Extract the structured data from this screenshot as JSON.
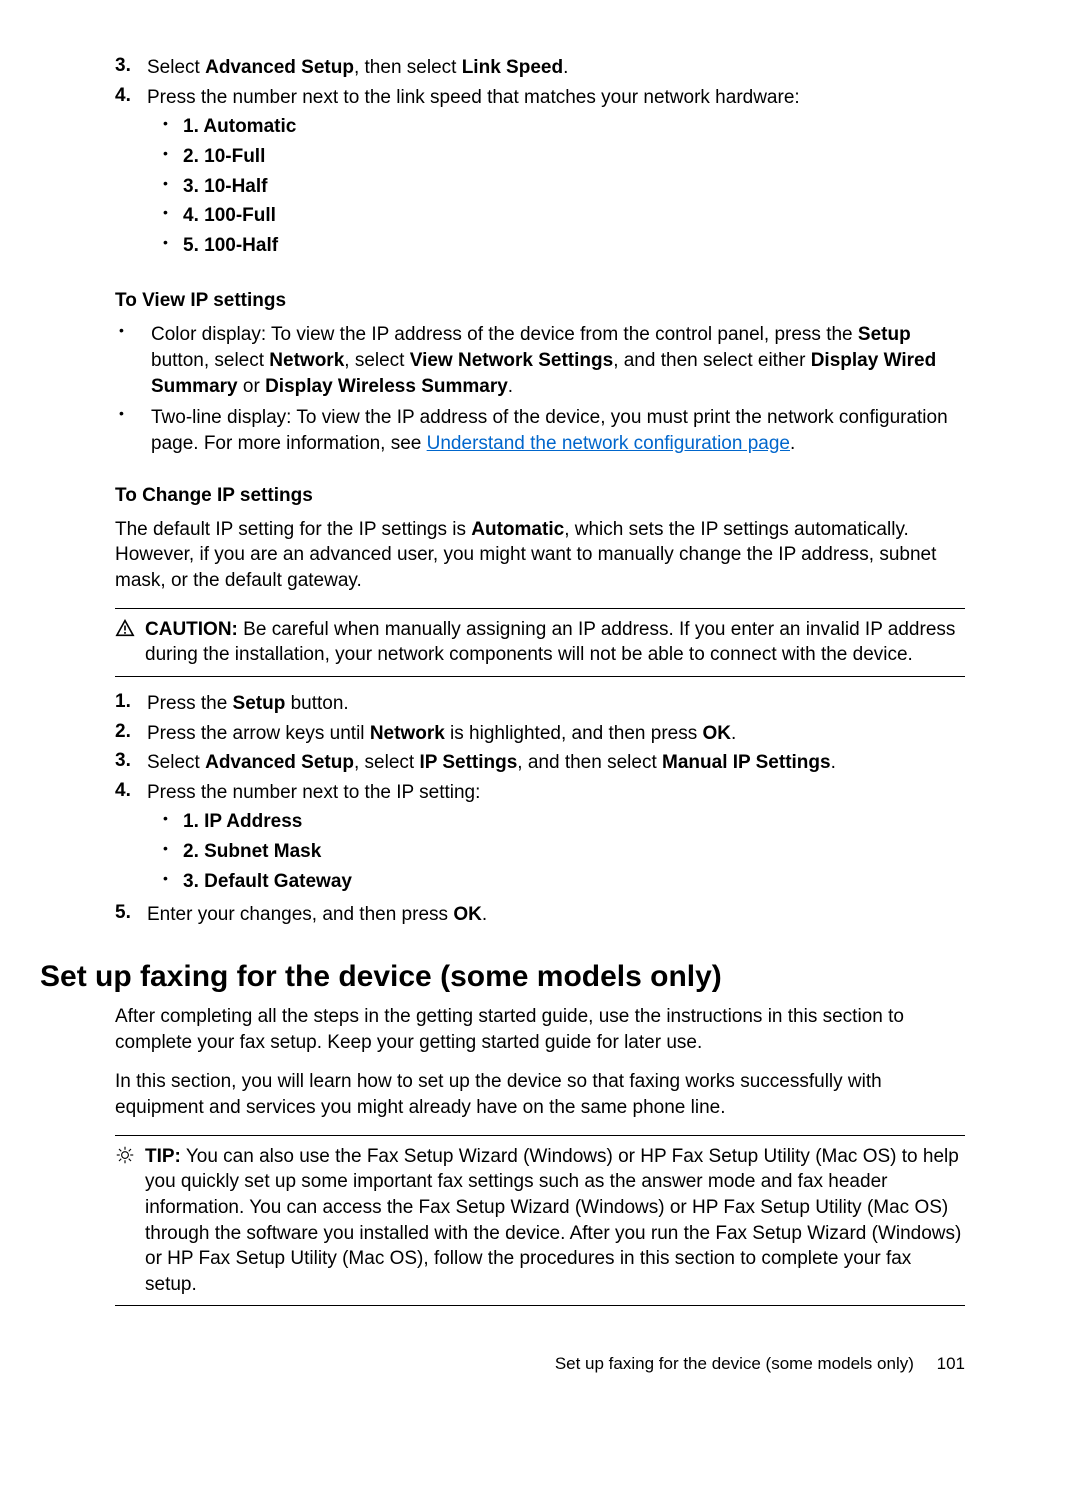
{
  "intro_list": [
    {
      "num": "3.",
      "pre": "Select ",
      "b1": "Advanced Setup",
      "mid": ", then select ",
      "b2": "Link Speed",
      "post": "."
    },
    {
      "num": "4.",
      "text": "Press the number next to the link speed that matches your network hardware:",
      "sub": [
        "1. Automatic",
        "2. 10-Full",
        "3. 10-Half",
        "4. 100-Full",
        "5. 100-Half"
      ]
    }
  ],
  "view_ip": {
    "heading": "To View IP settings",
    "items": [
      {
        "pre": "Color display: To view the IP address of the device from the control panel, press the ",
        "b1": "Setup",
        "m1": " button, select ",
        "b2": "Network",
        "m2": ", select ",
        "b3": "View Network Settings",
        "m3": ", and then select either ",
        "b4": "Display Wired Summary",
        "m4": " or ",
        "b5": "Display Wireless Summary",
        "post": "."
      },
      {
        "pre": "Two-line display: To view the IP address of the device, you must print the network configuration page. For more information, see ",
        "link": "Understand the network configuration page",
        "post": "."
      }
    ]
  },
  "change_ip": {
    "heading": "To Change IP settings",
    "para_pre": "The default IP setting for the IP settings is ",
    "para_bold": "Automatic",
    "para_post": ", which sets the IP settings automatically. However, if you are an advanced user, you might want to manually change the IP address, subnet mask, or the default gateway.",
    "caution_label": "CAUTION:",
    "caution_text": "Be careful when manually assigning an IP address. If you enter an invalid IP address during the installation, your network components will not be able to connect with the device.",
    "steps": [
      {
        "num": "1.",
        "pre": "Press the ",
        "b1": "Setup",
        "post": " button."
      },
      {
        "num": "2.",
        "pre": "Press the arrow keys until ",
        "b1": "Network",
        "mid": " is highlighted, and then press ",
        "b2": "OK",
        "post": "."
      },
      {
        "num": "3.",
        "pre": "Select ",
        "b1": "Advanced Setup",
        "m1": ", select ",
        "b2": "IP Settings",
        "m2": ", and then select ",
        "b3": "Manual IP Settings",
        "post": "."
      },
      {
        "num": "4.",
        "text": "Press the number next to the IP setting:",
        "sub": [
          "1. IP Address",
          "2. Subnet Mask",
          "3. Default Gateway"
        ]
      },
      {
        "num": "5.",
        "pre": "Enter your changes, and then press ",
        "b1": "OK",
        "post": "."
      }
    ]
  },
  "fax": {
    "heading": "Set up faxing for the device (some models only)",
    "para1": "After completing all the steps in the getting started guide, use the instructions in this section to complete your fax setup. Keep your getting started guide for later use.",
    "para2": "In this section, you will learn how to set up the device so that faxing works successfully with equipment and services you might already have on the same phone line.",
    "tip_label": "TIP:",
    "tip_text": "You can also use the Fax Setup Wizard (Windows) or HP Fax Setup Utility (Mac OS) to help you quickly set up some important fax settings such as the answer mode and fax header information. You can access the Fax Setup Wizard (Windows) or HP Fax Setup Utility (Mac OS) through the software you installed with the device. After you run the Fax Setup Wizard (Windows) or HP Fax Setup Utility (Mac OS), follow the procedures in this section to complete your fax setup."
  },
  "footer": {
    "text": "Set up faxing for the device (some models only)",
    "page": "101"
  }
}
